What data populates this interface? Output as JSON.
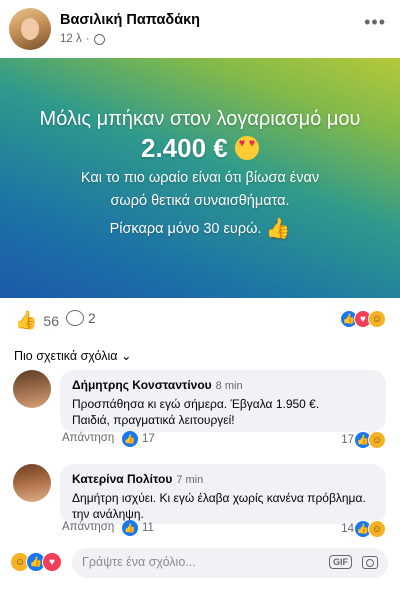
{
  "post": {
    "author": "Βασιλική Παπαδάκη",
    "time": "12 λ",
    "banner": {
      "line1": "Μόλις μπήκαν στον λογαριασμό μου",
      "amount": "2.400 €",
      "line3": "Και το πιο ωραίο είναι ότι βίωσα έναν",
      "line4": "σωρό θετικά συναισθήματα.",
      "line5": "Ρίσκαρα μόνο 30 ευρώ."
    },
    "likes": "56",
    "comments_count": "2"
  },
  "comments_section": {
    "sort_label": "Πιο σχετικά σχόλια",
    "comments": [
      {
        "name": "Δήμητρης Κονσταντίνου",
        "time": "8 min",
        "text_line1": "Προσπάθησα κι εγώ σήμερα. Έβγαλα 1.950 €.",
        "text_line2": "Παιδιά, πραγματικά λειτουργεί!",
        "reply": "Απάντηση",
        "like_count": "17",
        "reaction_count": "17"
      },
      {
        "name": "Κατερίνα Πολίτου",
        "time": "7 min",
        "text_line1": "Δημήτρη ισχύει. Κι εγώ έλαβα χωρίς κανένα πρόβλημα.",
        "text_line2": "την ανάληψη.",
        "reply": "Απάντηση",
        "like_count": "11",
        "reaction_count": "14"
      }
    ]
  },
  "composer": {
    "placeholder": "Γράψτε ένα σχόλιο...",
    "gif_label": "GIF"
  },
  "icons": {
    "more": "more-options-icon",
    "privacy": "globe-icon",
    "like": "like-icon",
    "comment": "comment-icon",
    "camera": "camera-icon"
  },
  "colors": {
    "brand_blue": "#1877f2",
    "love_red": "#f33e58",
    "haha_yellow": "#f7b125"
  }
}
